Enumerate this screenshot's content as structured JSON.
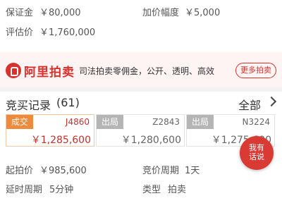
{
  "top_info": {
    "deposit_label": "保证金",
    "deposit_value": "￥80,000",
    "increment_label": "加价幅度",
    "increment_value": "￥5,000",
    "valuation_label": "评估价",
    "valuation_value": "￥1,760,000"
  },
  "brand": {
    "name": "阿里拍卖",
    "slogan": "司法拍卖零佣金，公开、透明、高效",
    "more_label": "更多拍卖",
    "color": "#d9312c"
  },
  "bid_records": {
    "title": "竞买记录",
    "count": "(61)",
    "all_label": "全部",
    "items": [
      {
        "status": "成交",
        "bidder": "J4860",
        "price": "￥1,285,600"
      },
      {
        "status": "出局",
        "bidder": "Z2843",
        "price": "￥1,280,600"
      },
      {
        "status": "出局",
        "bidder": "N3224",
        "price": "￥1,275,600"
      }
    ]
  },
  "details": {
    "start_price_label": "起拍价",
    "start_price_value": "￥985,600",
    "cycle_label": "竞价周期",
    "cycle_value": "1天",
    "delay_label": "延时周期",
    "delay_value": "5分钟",
    "type_label": "类型",
    "type_value": "拍卖"
  },
  "chat": {
    "line1": "我有",
    "line2": "话说"
  },
  "colors": {
    "accent": "#d9312c",
    "won": "#ed8a3b",
    "out": "#b5b5b5"
  }
}
